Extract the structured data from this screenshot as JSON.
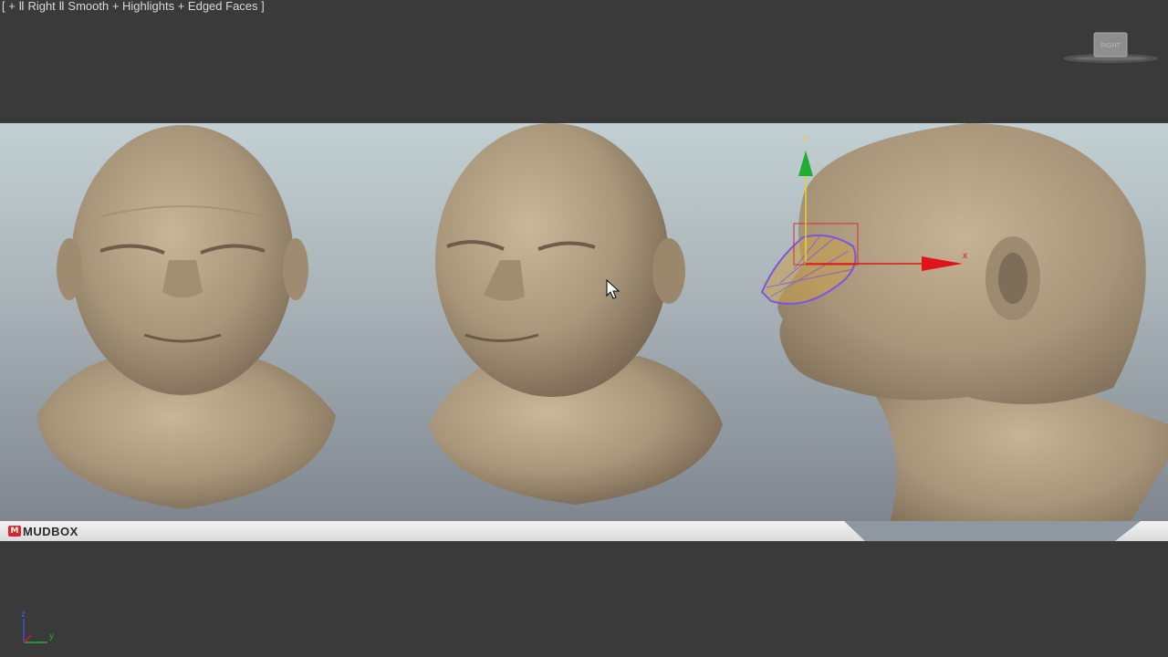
{
  "viewport": {
    "label": "[ + Ⅱ Right Ⅱ Smooth + Highlights + Edged Faces ]"
  },
  "viewcube": {
    "face_label": "RIGHT"
  },
  "banner": {
    "logo_mark": "M",
    "logo_text": "MUDBOX"
  },
  "axis_tripod": {
    "z_label": "z",
    "y_label": "y"
  },
  "gizmo": {
    "y_label": "y",
    "x_label": "x"
  },
  "icons": {
    "cursor": "arrow-cursor-icon",
    "transform": "move-gizmo-icon",
    "navigation": "viewcube-icon"
  },
  "colors": {
    "background": "#3a3a3a",
    "skin": "#b6a286",
    "gizmo_x": "#e0141a",
    "gizmo_y": "#1fae2f",
    "selection": "#7a56e6",
    "logo_red": "#d8262b"
  }
}
